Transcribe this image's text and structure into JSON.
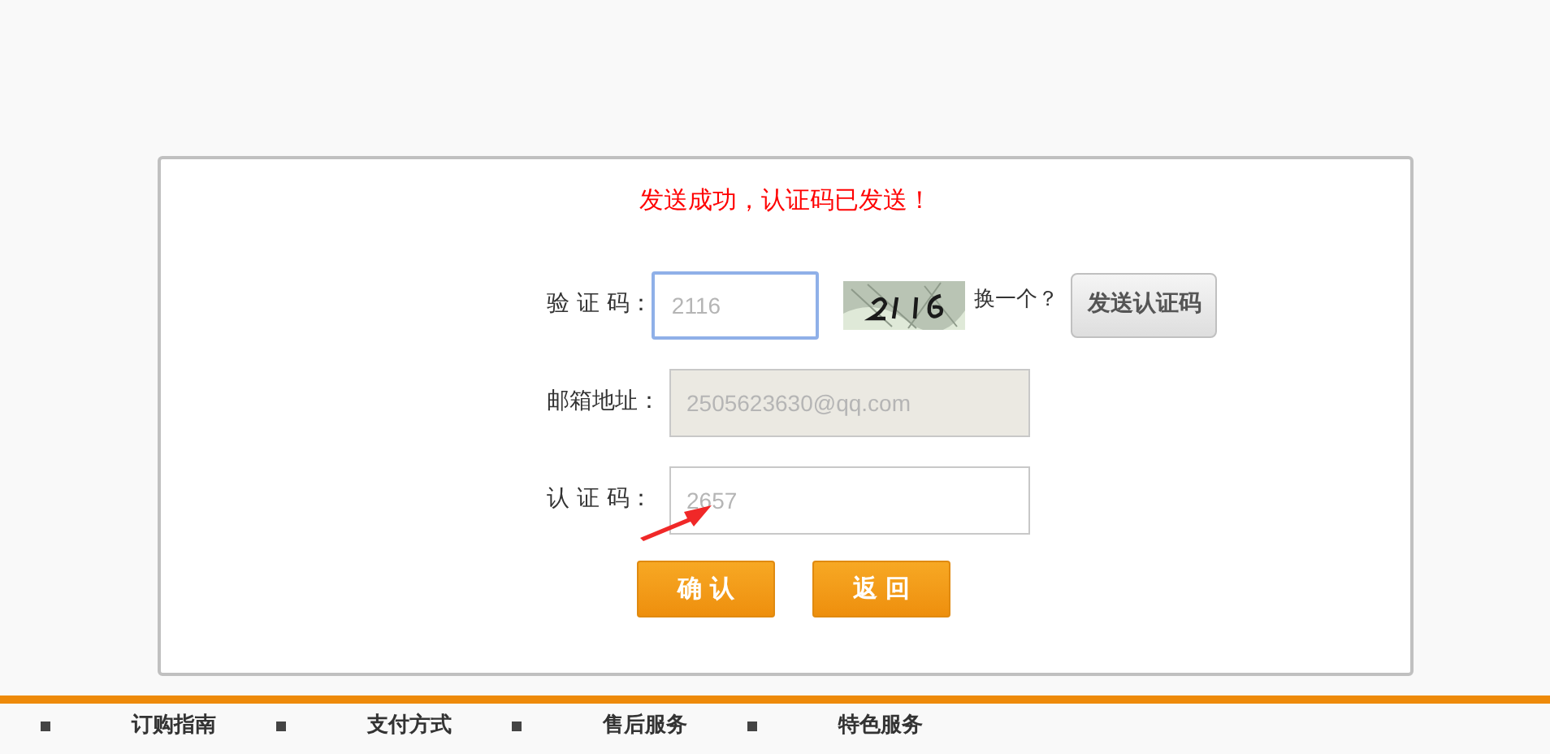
{
  "message": "发送成功，认证码已发送！",
  "fields": [
    {
      "kind": "captcha",
      "label": "验 证 码：",
      "value": "2116",
      "focused": true,
      "disabled": false,
      "refresh_text": "换一个？",
      "send_button": "发送认证码"
    },
    {
      "kind": "text",
      "label": "邮箱地址：",
      "value": "2505623630@qq.com",
      "focused": false,
      "disabled": true
    },
    {
      "kind": "text",
      "label": "认 证 码：",
      "value": "2657",
      "focused": false,
      "disabled": false
    }
  ],
  "buttons": [
    "确 认",
    "返 回"
  ],
  "footer_links": [
    "订购指南",
    "支付方式",
    "售后服务",
    "特色服务"
  ]
}
